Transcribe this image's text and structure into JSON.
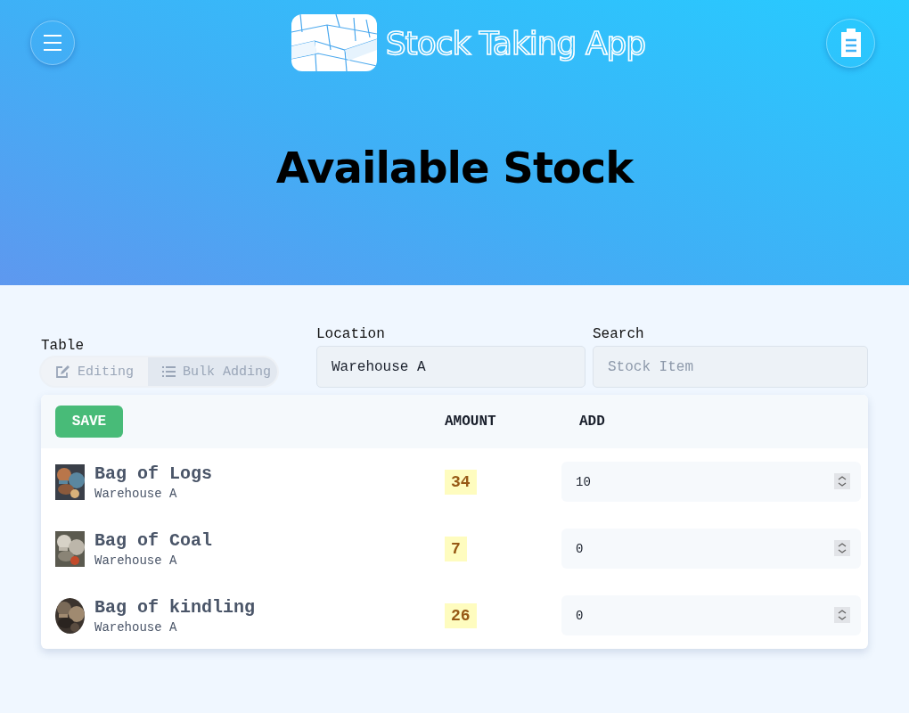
{
  "header": {
    "app_name": "Stock Taking App",
    "title": "Available Stock"
  },
  "table_mode": {
    "label": "Table",
    "options": [
      {
        "label": "Editing",
        "kind": "edit",
        "selected": false
      },
      {
        "label": "Bulk Adding",
        "kind": "list",
        "selected": true
      }
    ]
  },
  "location": {
    "label": "Location",
    "value": "Warehouse A"
  },
  "search": {
    "label": "Search",
    "placeholder": "Stock Item"
  },
  "table": {
    "save": "SAVE",
    "columns": [
      "AMOUNT",
      "ADD"
    ],
    "rows": [
      {
        "name": "Bag of Logs",
        "location": "Warehouse A",
        "amount": "34",
        "add": "10"
      },
      {
        "name": "Bag of Coal",
        "location": "Warehouse A",
        "amount": "7",
        "add": "0"
      },
      {
        "name": "Bag of kindling",
        "location": "Warehouse A",
        "amount": "26",
        "add": "0"
      }
    ]
  }
}
